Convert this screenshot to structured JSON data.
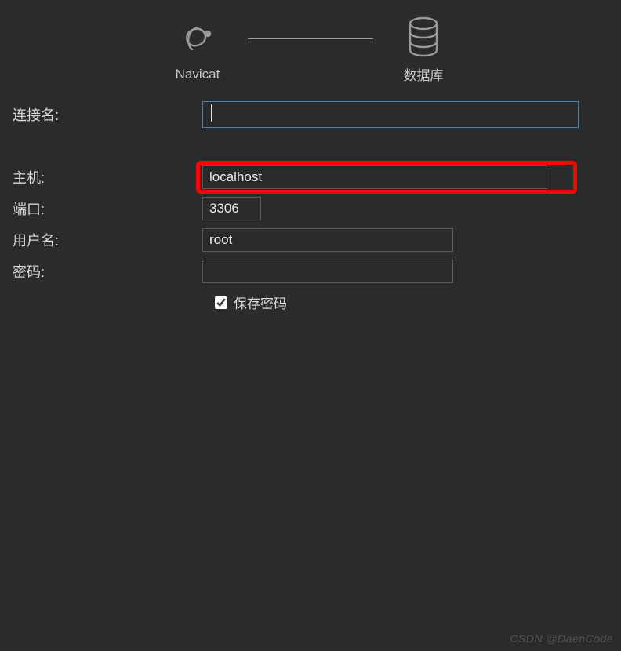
{
  "header": {
    "left_label": "Navicat",
    "right_label": "数据库"
  },
  "form": {
    "connection_name": {
      "label": "连接名:",
      "value": ""
    },
    "host": {
      "label": "主机:",
      "value": "localhost"
    },
    "port": {
      "label": "端口:",
      "value": "3306"
    },
    "username": {
      "label": "用户名:",
      "value": "root"
    },
    "password": {
      "label": "密码:",
      "value": ""
    },
    "save_password": {
      "label": "保存密码",
      "checked": true
    }
  },
  "watermark": "CSDN @DaenCode"
}
